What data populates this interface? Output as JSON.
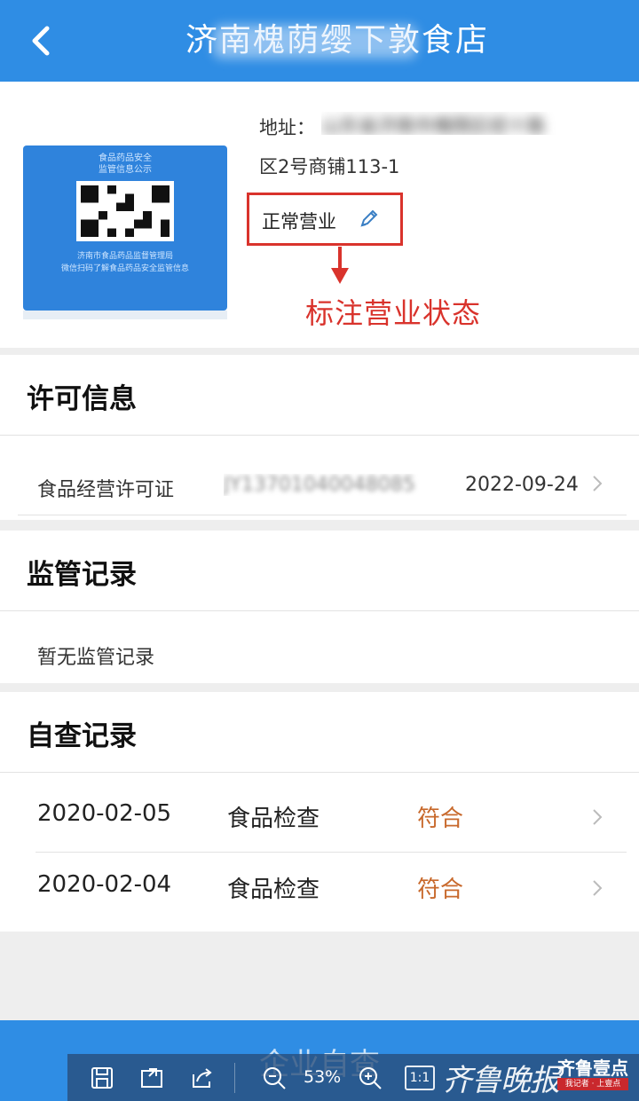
{
  "header": {
    "title": "济南槐荫缨下敦食店",
    "back_icon": "chevron-left-icon"
  },
  "shop": {
    "qr_board": {
      "heading_line1": "食品药品安全",
      "heading_line2": "监管信息公示",
      "footer_line1": "济南市食品药品监督管理局",
      "footer_line2": "微信扫码了解食品药品安全监管信息"
    },
    "address_label": "地址：",
    "address_line1_masked": "山东省济南市槐荫区经十路",
    "address_line2": "区2号商铺113-1",
    "status": "正常营业",
    "status_edit_icon": "pencil-icon",
    "annotation": "标注营业状态",
    "annotation_color": "#d9332c"
  },
  "license": {
    "title": "许可信息",
    "rows": [
      {
        "name": "食品经营许可证",
        "number_masked": "JY13701040048085",
        "date": "2022-09-24"
      }
    ]
  },
  "supervision": {
    "title": "监管记录",
    "empty_text": "暂无监管记录"
  },
  "self_check": {
    "title": "自查记录",
    "result_color": "#c8692c",
    "rows": [
      {
        "date": "2020-02-05",
        "type": "食品检查",
        "result": "符合"
      },
      {
        "date": "2020-02-04",
        "type": "食品检查",
        "result": "符合"
      }
    ]
  },
  "bottom_button": {
    "label": "企业自查"
  },
  "viewer": {
    "zoom": "53%",
    "ratio_label": "1:1"
  },
  "watermark": {
    "text": "齐鲁晚报",
    "logo": "齐鲁壹点",
    "logo_sub": "我记者 · 上壹点"
  },
  "colors": {
    "primary": "#2f8de4",
    "annotation_red": "#d9332c",
    "result_orange": "#c8692c"
  }
}
